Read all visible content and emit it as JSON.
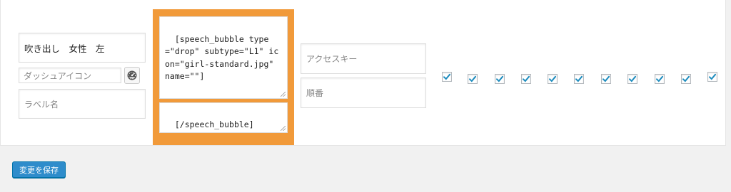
{
  "row": {
    "title_value": "吹き出し　女性　左",
    "dashicon_placeholder": "ダッシュアイコン",
    "label_placeholder": "ラベル名",
    "open_tag": "[speech_bubble type=\"drop\" subtype=\"L1\" icon=\"girl-standard.jpg\" name=\"\"]",
    "close_tag": "[/speech_bubble]",
    "accesskey_placeholder": "アクセスキー",
    "order_placeholder": "順番",
    "checkboxes": [
      true,
      true,
      true,
      true,
      true,
      true,
      true,
      true,
      true,
      true,
      true
    ]
  },
  "save_label": "変更を保存",
  "colors": {
    "highlight": "#f19a3a",
    "check": "#1e8cbe",
    "button": "#2e8ccb"
  },
  "icons": {
    "dashicon_button": "dashboard-gauge-icon",
    "checkmark": "checkmark-icon"
  }
}
